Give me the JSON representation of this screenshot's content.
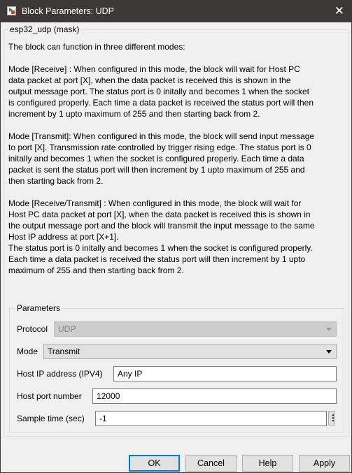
{
  "window": {
    "title": "Block Parameters: UDP",
    "close_icon": "close-icon",
    "app_icon": "simulink-block-icon"
  },
  "mask": {
    "title": "esp32_udp (mask)",
    "description": [
      "The block can function in three different modes:",
      "",
      "Mode [Receive] : When configured in this mode, the block will wait for Host PC",
      "data packet at port [X], when the data packet is received this is shown in the",
      "output message port. The status port is 0 initally and becomes 1 when the socket",
      "is configured properly. Each time a data packet is received the status port will then",
      "increment by 1 upto maximum of 255 and then starting back from 2.",
      "",
      "Mode [Transmit]: When configured in this mode, the block will send input message",
      "to port [X]. Transmission rate controlled by trigger rising edge. The status port is 0",
      "initally and becomes 1 when the socket is configured properly. Each time a data",
      "packet is sent the status port will then increment by 1 upto maximum of 255 and",
      "then starting back from 2.",
      "",
      "Mode [Receive/Transmit] : When configured in this mode, the block will wait for",
      "Host PC data packet at port [X], when the data packet is received this is shown in",
      "the output message port and the block will transmit the input message to the same",
      "Host IP address at port [X+1].",
      "The status port is 0 initally and becomes 1 when the socket is configured properly.",
      "Each time a data packet is received the status port will then increment by 1 upto",
      "maximum of 255 and then starting back from 2."
    ]
  },
  "parameters": {
    "title": "Parameters",
    "protocol": {
      "label": "Protocol",
      "value": "UDP",
      "enabled": false
    },
    "mode": {
      "label": "Mode",
      "value": "Transmit"
    },
    "host_ip": {
      "label": "Host IP address (IPV4)",
      "value": "Any IP"
    },
    "host_port": {
      "label": "Host port number",
      "value": "12000"
    },
    "sample_time": {
      "label": "Sample time (sec)",
      "value": "-1",
      "more_icon": "⋮"
    }
  },
  "buttons": {
    "ok": "OK",
    "cancel": "Cancel",
    "help": "Help",
    "apply": "Apply"
  },
  "colors": {
    "titlebar": "#3c3a38",
    "default_button_border": "#0078d7"
  }
}
